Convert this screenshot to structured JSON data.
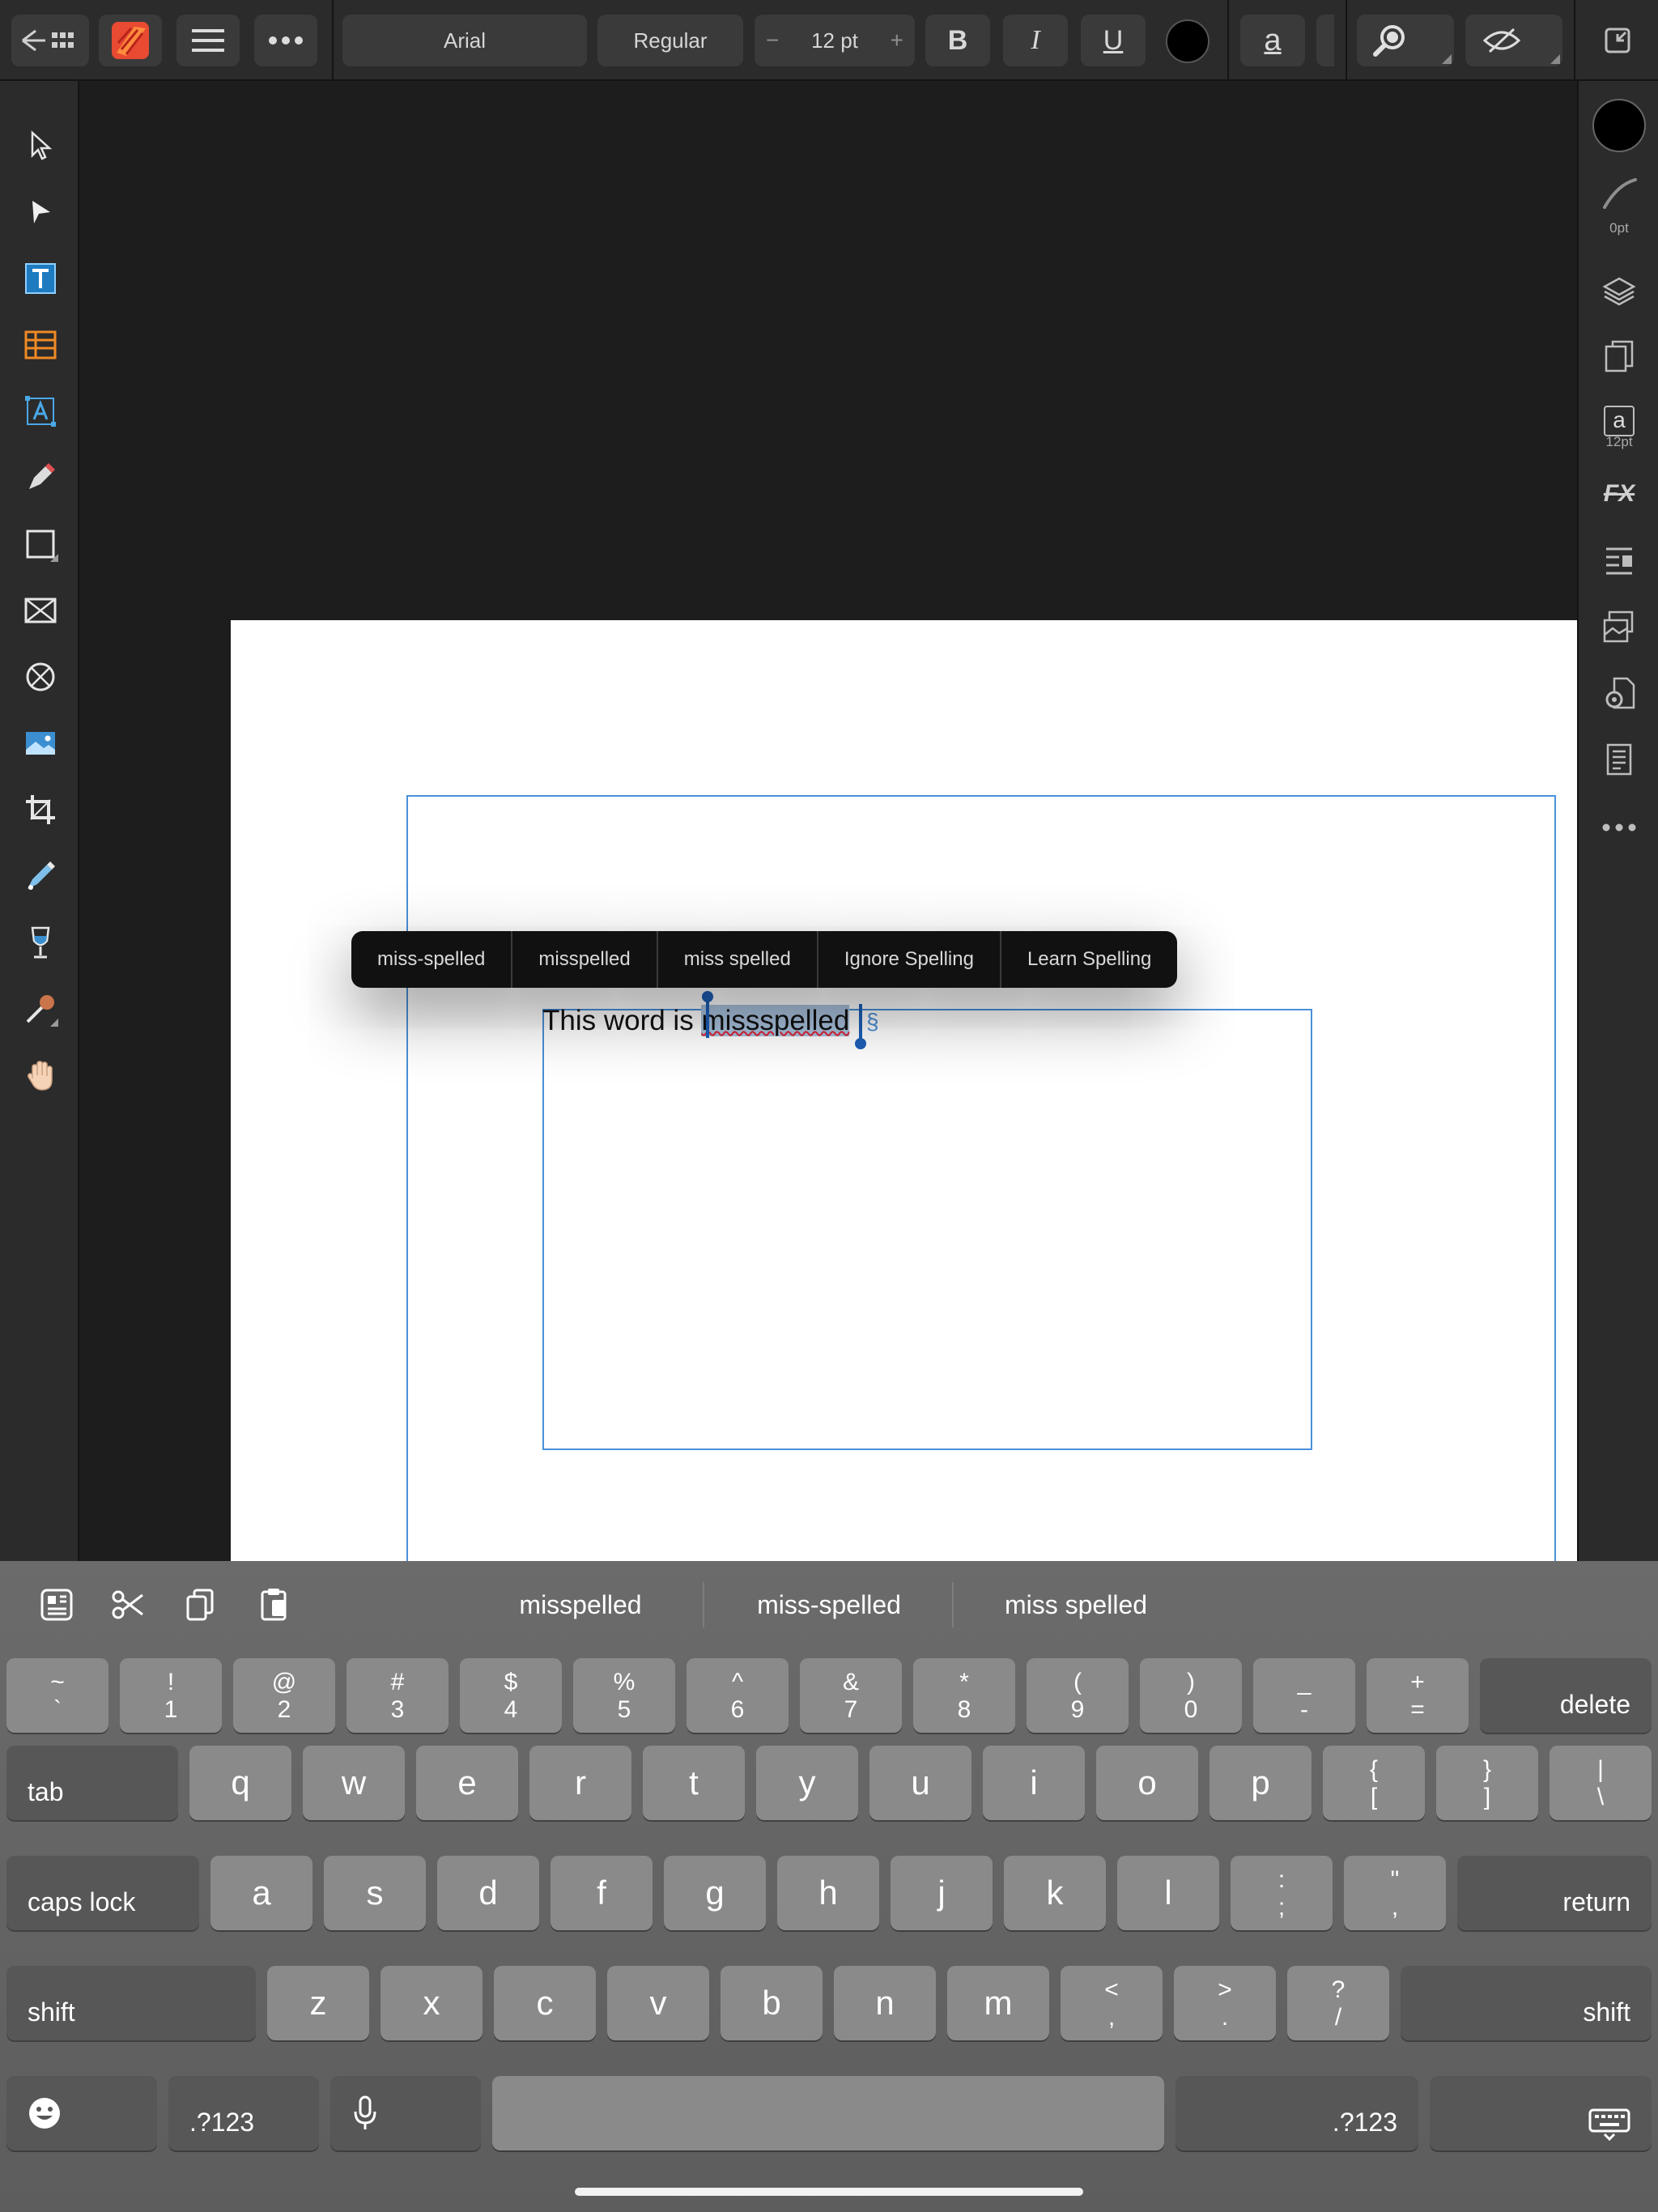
{
  "toolbar": {
    "font_family": "Arial",
    "font_style": "Regular",
    "font_size": "12 pt",
    "minus": "−",
    "plus": "+",
    "bold": "B",
    "italic": "I",
    "underline": "U",
    "char_style": "a",
    "color_hex": "#000000"
  },
  "right_panel": {
    "stroke_width": "0pt",
    "char_size": "12pt",
    "char_glyph": "a",
    "fx": "FX"
  },
  "document": {
    "text_before": "This word is ",
    "selected_word": "missspelled",
    "para_mark": "§"
  },
  "context_menu": {
    "items": [
      "miss-spelled",
      "misspelled",
      "miss spelled",
      "Ignore Spelling",
      "Learn Spelling"
    ]
  },
  "keyboard": {
    "suggestions": [
      "misspelled",
      "miss-spelled",
      "miss spelled"
    ],
    "row1": [
      {
        "top": "~",
        "bot": "`"
      },
      {
        "top": "!",
        "bot": "1"
      },
      {
        "top": "@",
        "bot": "2"
      },
      {
        "top": "#",
        "bot": "3"
      },
      {
        "top": "$",
        "bot": "4"
      },
      {
        "top": "%",
        "bot": "5"
      },
      {
        "top": "^",
        "bot": "6"
      },
      {
        "top": "&",
        "bot": "7"
      },
      {
        "top": "*",
        "bot": "8"
      },
      {
        "top": "(",
        "bot": "9"
      },
      {
        "top": ")",
        "bot": "0"
      },
      {
        "top": "_",
        "bot": "-"
      },
      {
        "top": "+",
        "bot": "="
      }
    ],
    "delete": "delete",
    "tab": "tab",
    "row2": [
      "q",
      "w",
      "e",
      "r",
      "t",
      "y",
      "u",
      "i",
      "o",
      "p"
    ],
    "row2_sym": [
      {
        "top": "{",
        "bot": "["
      },
      {
        "top": "}",
        "bot": "]"
      },
      {
        "top": "|",
        "bot": "\\"
      }
    ],
    "caps_lock": "caps lock",
    "row3": [
      "a",
      "s",
      "d",
      "f",
      "g",
      "h",
      "j",
      "k",
      "l"
    ],
    "row3_sym": [
      {
        "top": ":",
        "bot": ";"
      },
      {
        "top": "\"",
        "bot": ","
      }
    ],
    "return": "return",
    "shift": "shift",
    "row4": [
      "z",
      "x",
      "c",
      "v",
      "b",
      "n",
      "m"
    ],
    "row4_sym": [
      {
        "top": "<",
        "bot": ","
      },
      {
        "top": ">",
        "bot": "."
      },
      {
        "top": "?",
        "bot": "/"
      }
    ],
    "numbers_label": ".?123"
  }
}
